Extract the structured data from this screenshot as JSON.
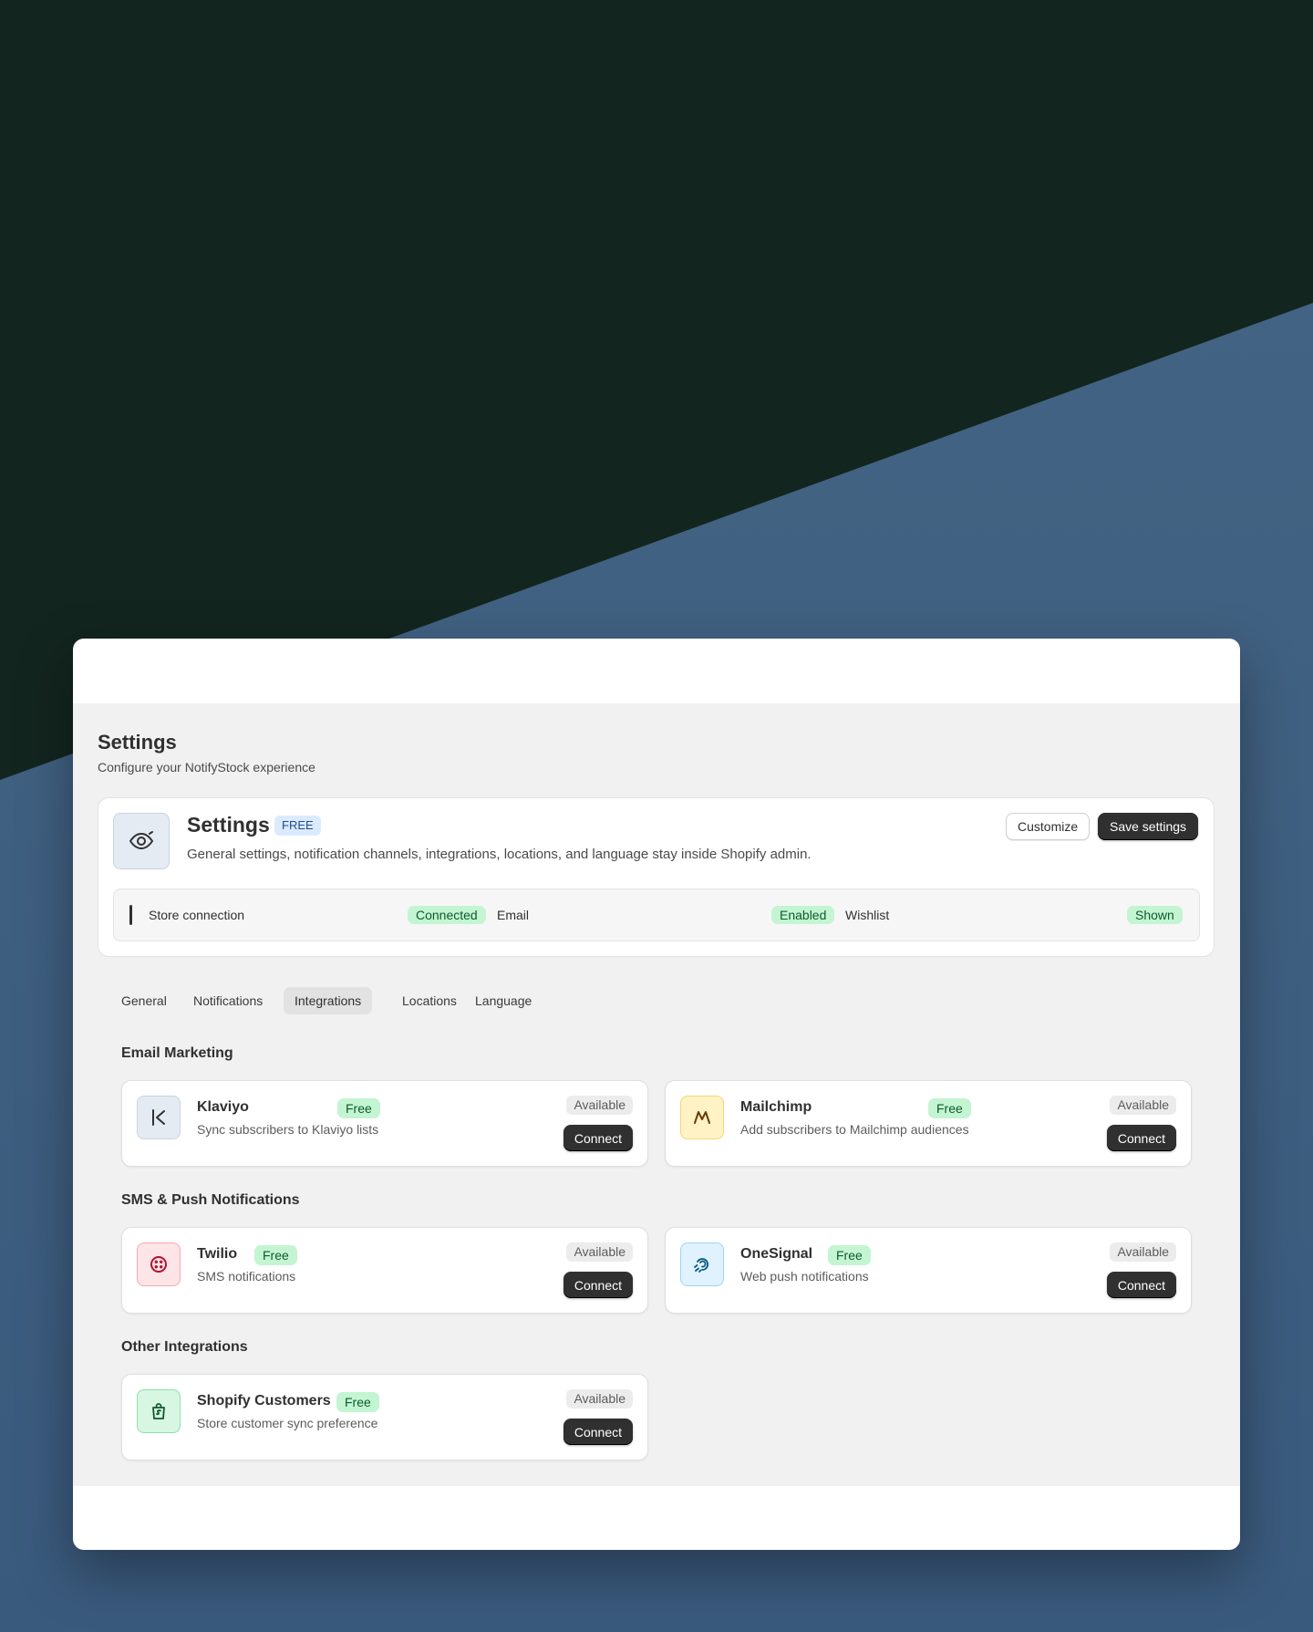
{
  "page": {
    "title": "Settings",
    "subtitle": "Configure your NotifyStock experience"
  },
  "hero": {
    "title": "Settings",
    "badge": "FREE",
    "description": "General settings, notification channels, integrations, locations, and language stay inside Shopify admin.",
    "icon": "eye-icon",
    "customize_label": "Customize",
    "save_label": "Save settings"
  },
  "status": [
    {
      "label": "Store connection",
      "value": "Connected"
    },
    {
      "label": "Email",
      "value": "Enabled"
    },
    {
      "label": "Wishlist",
      "value": "Shown"
    }
  ],
  "tabs": [
    {
      "label": "General",
      "active": false
    },
    {
      "label": "Notifications",
      "active": false
    },
    {
      "label": "Integrations",
      "active": true
    },
    {
      "label": "Locations",
      "active": false
    },
    {
      "label": "Language",
      "active": false
    }
  ],
  "sections": [
    {
      "title": "Email Marketing",
      "integrations": [
        {
          "name": "Klaviyo",
          "badge": "Free",
          "description": "Sync subscribers to Klaviyo lists",
          "status": "Available",
          "action": "Connect",
          "icon": "klaviyo-icon"
        },
        {
          "name": "Mailchimp",
          "badge": "Free",
          "description": "Add subscribers to Mailchimp audiences",
          "status": "Available",
          "action": "Connect",
          "icon": "mailchimp-icon"
        }
      ]
    },
    {
      "title": "SMS & Push Notifications",
      "integrations": [
        {
          "name": "Twilio",
          "badge": "Free",
          "description": "SMS notifications",
          "status": "Available",
          "action": "Connect",
          "icon": "twilio-icon"
        },
        {
          "name": "OneSignal",
          "badge": "Free",
          "description": "Web push notifications",
          "status": "Available",
          "action": "Connect",
          "icon": "onesignal-icon"
        }
      ]
    },
    {
      "title": "Other Integrations",
      "integrations": [
        {
          "name": "Shopify Customers",
          "badge": "Free",
          "description": "Store customer sync preference",
          "status": "Available",
          "action": "Connect",
          "icon": "shopify-bag-icon"
        }
      ]
    }
  ],
  "colors": {
    "background_dark": "#13251f",
    "background_blue": "#3d5d80",
    "primary_button": "#303030",
    "success_badge": "#c3f5d2",
    "info_badge": "#dbeafe"
  }
}
